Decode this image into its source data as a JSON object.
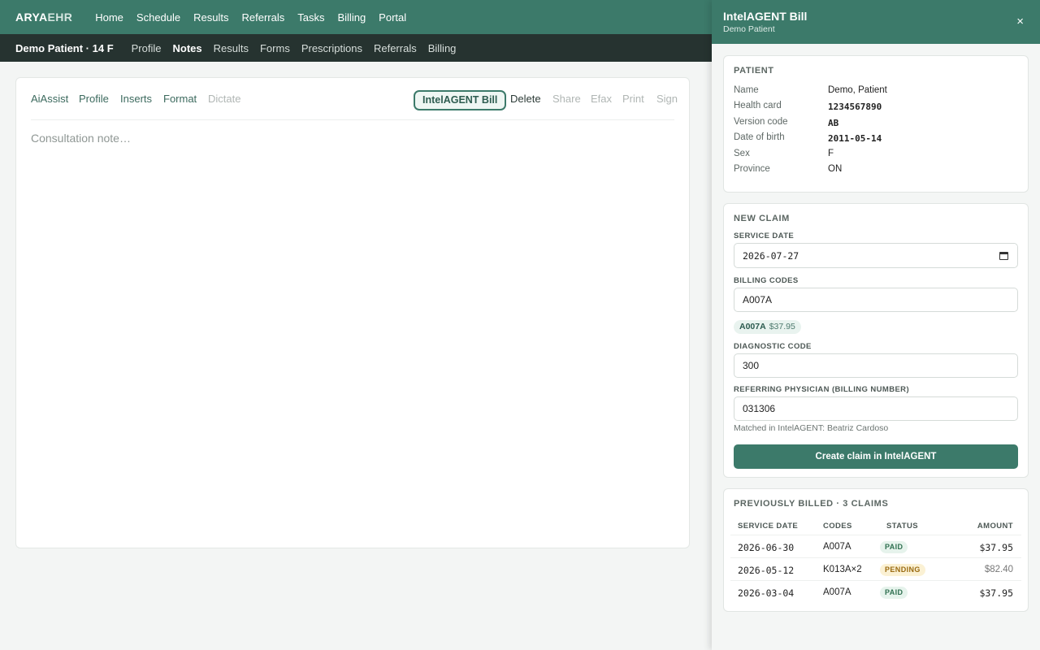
{
  "topnav": {
    "brand_primary": "ARYA",
    "brand_secondary": "EHR",
    "items": [
      "Home",
      "Schedule",
      "Results",
      "Referrals",
      "Tasks",
      "Billing",
      "Portal"
    ]
  },
  "patient_bar": {
    "patient": "Demo Patient · 14 F",
    "tabs": [
      "Profile",
      "Notes",
      "Results",
      "Forms",
      "Prescriptions",
      "Referrals",
      "Billing"
    ],
    "active_tab": "Notes"
  },
  "note": {
    "tools": {
      "aiassist": "AiAssist",
      "profile": "Profile",
      "inserts": "Inserts",
      "format": "Format",
      "dictate": "Dictate",
      "bill": "IntelAGENT Bill",
      "delete": "Delete",
      "share": "Share",
      "efax": "Efax",
      "print": "Print",
      "sign": "Sign"
    },
    "placeholder": "Consultation note…",
    "value": ""
  },
  "panel": {
    "title": "IntelAGENT Bill",
    "subtitle": "Demo Patient",
    "close": "×",
    "patient_section": {
      "title": "PATIENT",
      "name_label": "Name",
      "name": "Demo, Patient",
      "health_card_label": "Health card",
      "health_card": "1234567890",
      "version_label": "Version code",
      "version": "AB",
      "dob_label": "Date of birth",
      "dob": "2011-05-14",
      "sex_label": "Sex",
      "sex": "F",
      "province_label": "Province",
      "province": "ON"
    },
    "claim": {
      "title": "NEW CLAIM",
      "service_date_label": "SERVICE DATE",
      "service_date": "2026-07-27",
      "billing_codes_label": "BILLING CODES",
      "billing_codes": "A007A",
      "chip_code": "A007A",
      "chip_price": "$37.95",
      "diagnostic_label": "DIAGNOSTIC CODE",
      "diagnostic": "300",
      "referring_label": "REFERRING PHYSICIAN (BILLING NUMBER)",
      "referring": "031306",
      "match_note": "Matched in IntelAGENT: Beatriz Cardoso",
      "create_button": "Create claim in IntelAGENT"
    },
    "history": {
      "title": "PREVIOUSLY BILLED · 3 CLAIMS",
      "headers": {
        "date": "SERVICE DATE",
        "codes": "CODES",
        "status": "STATUS",
        "amount": "AMOUNT"
      },
      "rows": [
        {
          "date": "2026-06-30",
          "codes": "A007A",
          "status": "PAID",
          "amount": "$37.95"
        },
        {
          "date": "2026-05-12",
          "codes": "K013A×2",
          "status": "PENDING",
          "amount": "$82.40"
        },
        {
          "date": "2026-03-04",
          "codes": "A007A",
          "status": "PAID",
          "amount": "$37.95"
        }
      ]
    }
  },
  "colors": {
    "primary": "#3c7a6a",
    "patient_bar": "#263330",
    "paid": "#2f7050",
    "pending": "#9a6a10"
  }
}
